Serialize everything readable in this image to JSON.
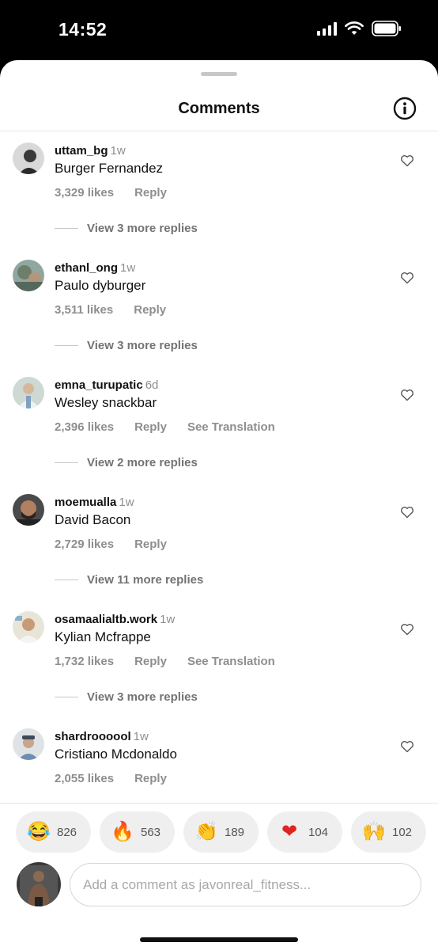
{
  "status": {
    "time": "14:52"
  },
  "sheet": {
    "title": "Comments"
  },
  "comments": [
    {
      "username": "uttam_bg",
      "time": "1w",
      "text": "Burger Fernandez",
      "likes": "3,329 likes",
      "reply": "Reply",
      "translate": "",
      "replies": "View 3 more replies"
    },
    {
      "username": "ethanl_ong",
      "time": "1w",
      "text": "Paulo dyburger",
      "likes": "3,511 likes",
      "reply": "Reply",
      "translate": "",
      "replies": "View 3 more replies"
    },
    {
      "username": "emna_turupatic",
      "time": "6d",
      "text": "Wesley snackbar",
      "likes": "2,396 likes",
      "reply": "Reply",
      "translate": "See Translation",
      "replies": "View 2 more replies"
    },
    {
      "username": "moemualla",
      "time": "1w",
      "text": "David Bacon",
      "likes": "2,729 likes",
      "reply": "Reply",
      "translate": "",
      "replies": "View 11 more replies"
    },
    {
      "username": "osamaalialtb.work",
      "time": "1w",
      "text": "Kylian Mcfrappe",
      "likes": "1,732 likes",
      "reply": "Reply",
      "translate": "See Translation",
      "replies": "View 3 more replies"
    },
    {
      "username": "shardroooool",
      "time": "1w",
      "text": "Cristiano Mcdonaldo",
      "likes": "2,055 likes",
      "reply": "Reply",
      "translate": "",
      "replies": ""
    }
  ],
  "reactions": [
    {
      "icon": "laughing-emoji-icon",
      "emoji": "😂",
      "count": "826"
    },
    {
      "icon": "fire-emoji-icon",
      "emoji": "🔥",
      "count": "563"
    },
    {
      "icon": "clapping-emoji-icon",
      "emoji": "👏",
      "count": "189"
    },
    {
      "icon": "heart-emoji-icon",
      "emoji": "❤",
      "count": "104"
    },
    {
      "icon": "raised-hands-emoji-icon",
      "emoji": "🙌",
      "count": "102"
    }
  ],
  "composer": {
    "placeholder": "Add a comment as javonreal_fitness..."
  },
  "colors": {
    "muted": "#8e8e8e",
    "chip": "#efefef",
    "heart": "#e0241f"
  }
}
